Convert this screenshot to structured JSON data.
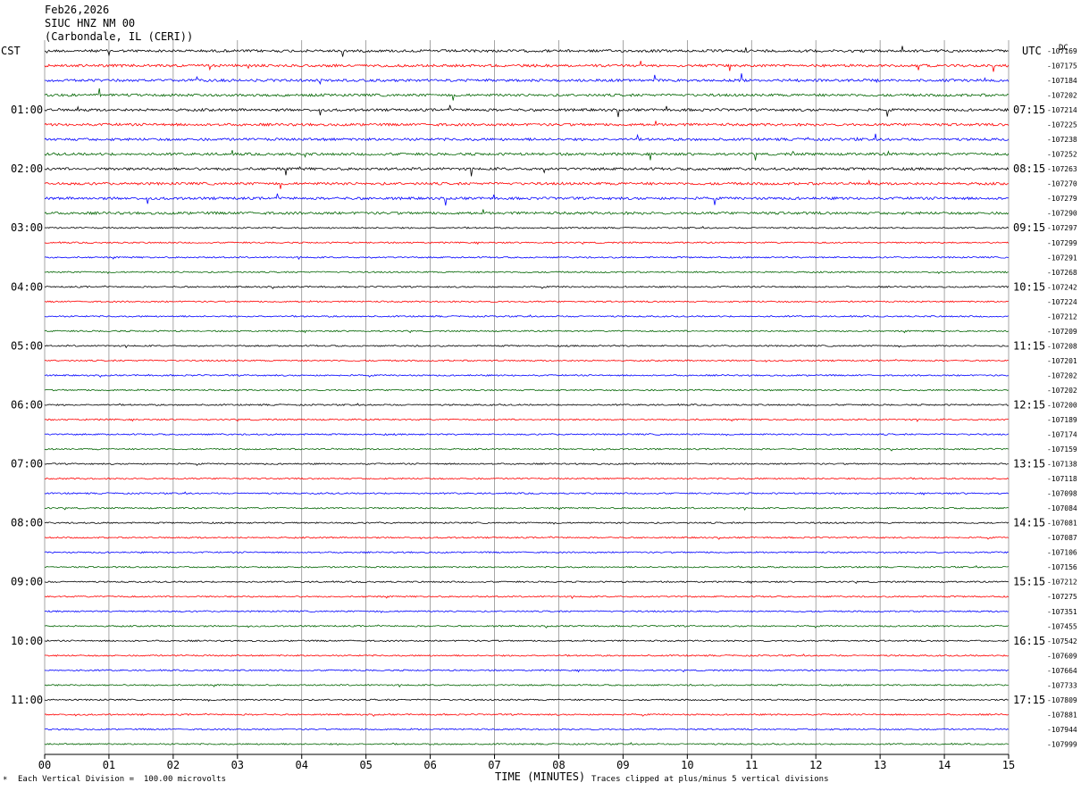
{
  "header": {
    "date": "Feb26,2026",
    "station": "SIUC HNZ NM 00",
    "location": "(Carbondale, IL (CERI))"
  },
  "left_timezone": "CST",
  "right_timezone": "UTC",
  "corner_tag": "DC",
  "footer": {
    "scale_note": "Each Vertical Division =  100.00 microvolts",
    "clip_note": "Traces clipped at plus/minus 5 vertical divisions",
    "corner_mark": "*"
  },
  "chart_data": {
    "type": "line",
    "title": "",
    "xlabel": "TIME (MINUTES)",
    "ylabel": "",
    "xlim": [
      0,
      15
    ],
    "x_ticks": [
      "00",
      "01",
      "02",
      "03",
      "04",
      "05",
      "06",
      "07",
      "08",
      "09",
      "10",
      "11",
      "12",
      "13",
      "14",
      "15"
    ],
    "grid": true,
    "trace_colors": [
      "#000000",
      "#ff0000",
      "#0000ff",
      "#006400"
    ],
    "left_time_labels": [
      "01:00",
      "02:00",
      "03:00",
      "04:00",
      "05:00",
      "06:00",
      "07:00",
      "08:00",
      "09:00",
      "10:00",
      "11:00"
    ],
    "right_time_labels": [
      "07:15",
      "08:15",
      "09:15",
      "10:15",
      "11:15",
      "12:15",
      "13:15",
      "14:15",
      "15:15",
      "16:15",
      "17:15"
    ],
    "trace_offsets": [
      "-107169",
      "-107175",
      "-107184",
      "-107202",
      "-107214",
      "-107225",
      "-107238",
      "-107252",
      "-107263",
      "-107270",
      "-107279",
      "-107290",
      "-107297",
      "-107299",
      "-107291",
      "-107268",
      "-107242",
      "-107224",
      "-107212",
      "-107209",
      "-107208",
      "-107201",
      "-107202",
      "-107202",
      "-107200",
      "-107189",
      "-107174",
      "-107159",
      "-107138",
      "-107118",
      "-107098",
      "-107084",
      "-107081",
      "-107087",
      "-107106",
      "-107156",
      "-107212",
      "-107275",
      "-107351",
      "-107455",
      "-107542",
      "-107609",
      "-107664",
      "-107733",
      "-107809",
      "-107881",
      "-107944",
      "-107999"
    ]
  }
}
